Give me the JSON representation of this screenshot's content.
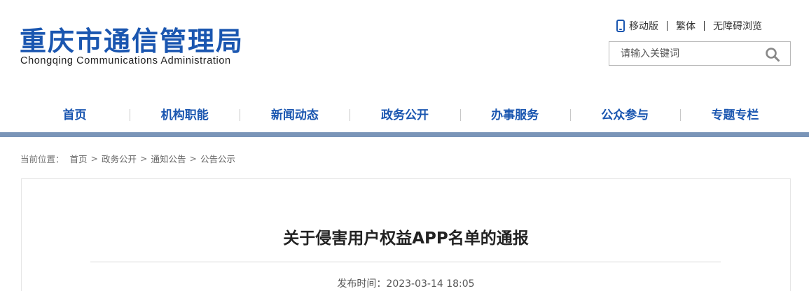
{
  "header": {
    "site_name": "重庆市通信管理局",
    "site_name_en": "Chongqing Communications Administration",
    "top_links": {
      "mobile": "移动版",
      "traditional": "繁体",
      "accessible": "无障碍浏览"
    },
    "search": {
      "placeholder": "请输入关键词"
    }
  },
  "nav": {
    "items": [
      "首页",
      "机构职能",
      "新闻动态",
      "政务公开",
      "办事服务",
      "公众参与",
      "专题专栏"
    ]
  },
  "breadcrumb": {
    "prefix": "当前位置：",
    "items": [
      "首页",
      "政务公开",
      "通知公告",
      "公告公示"
    ],
    "separator": ">"
  },
  "article": {
    "title": "关于侵害用户权益APP名单的通报",
    "publish_label": "发布时间：",
    "publish_time": "2023-03-14 18:05"
  },
  "colors": {
    "brand_blue": "#1a56b0",
    "nav_bar": "#7a95b8"
  },
  "icons": {
    "mobile": "phone-icon",
    "search": "search-icon"
  }
}
